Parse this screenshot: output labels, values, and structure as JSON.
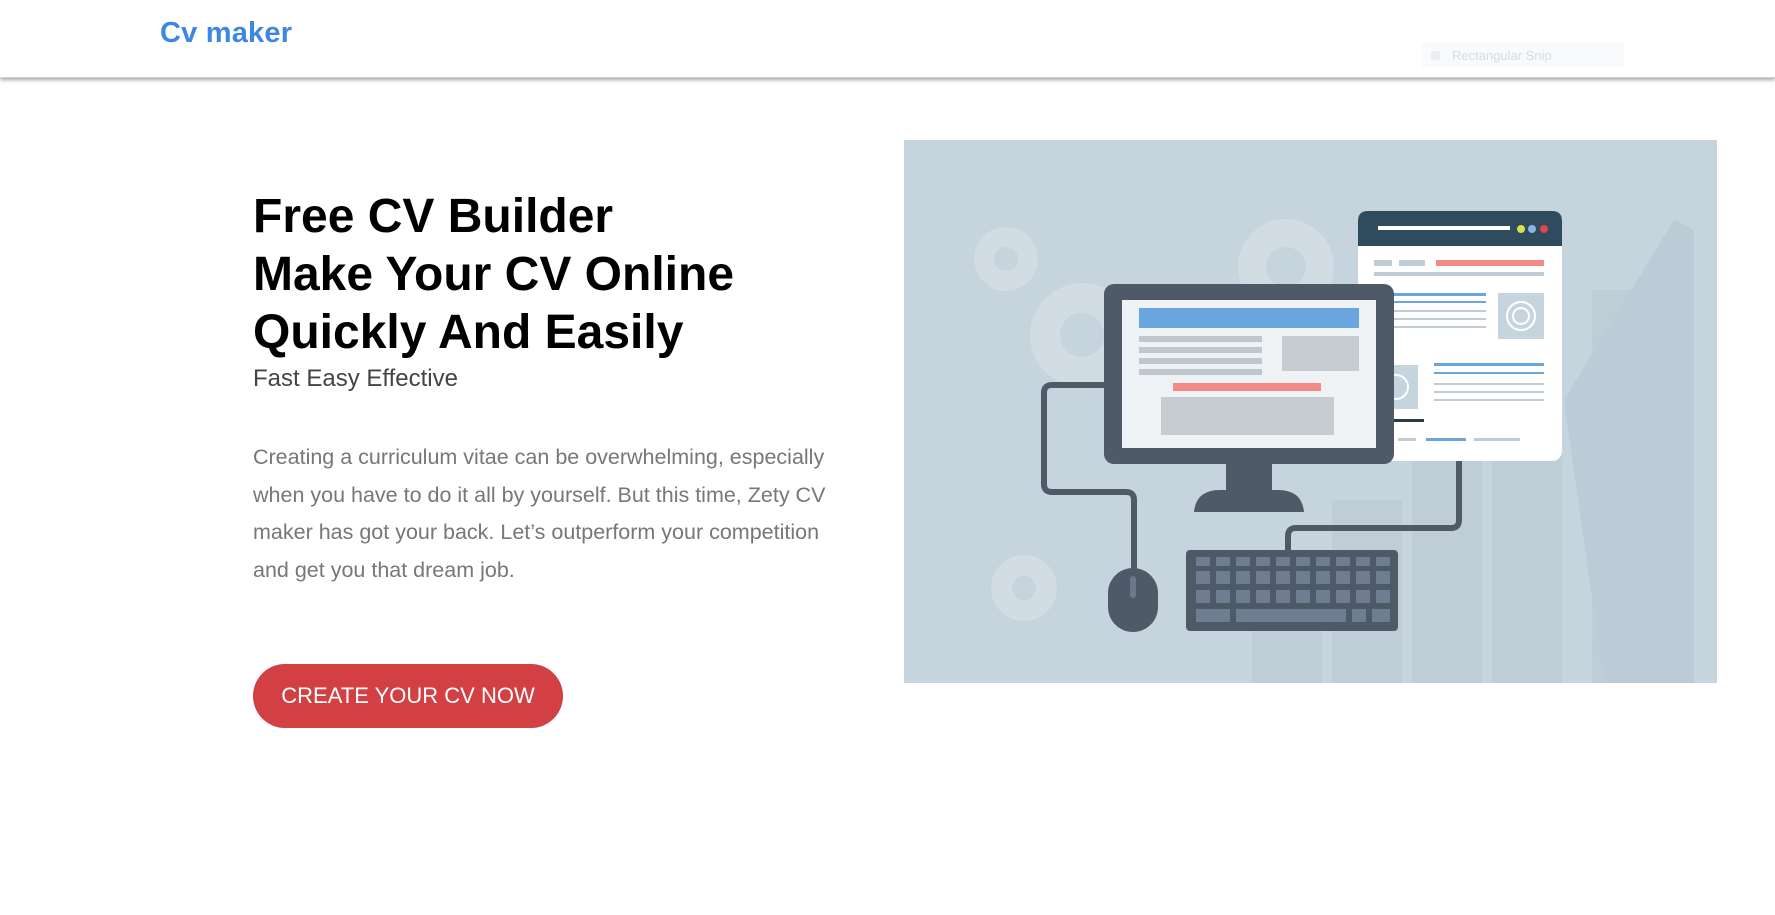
{
  "navbar": {
    "brand": "Cv maker"
  },
  "overlay": {
    "snip_tooltip": "Rectangular Snip"
  },
  "hero": {
    "title_lines": [
      "Free CV Builder",
      "Make Your CV Online",
      "Quickly And Easily"
    ],
    "subtitle": "Fast Easy Effective",
    "description": "Creating a curriculum vitae can be overwhelming, especially when you have to do it all by yourself. But this time, Zety CV maker has got your back. Let’s outperform your competition and get you that dream job.",
    "cta_label": "CREATE YOUR CV NOW"
  },
  "colors": {
    "brand": "#3d86e6",
    "cta": "#d24043",
    "illustration_bg": "#c6d4dd",
    "monitor": "#4f5a69",
    "accent_blue": "#68a6dd",
    "accent_red": "#f28b87"
  },
  "illustration": {
    "icon": "computer-cv-illustration"
  }
}
